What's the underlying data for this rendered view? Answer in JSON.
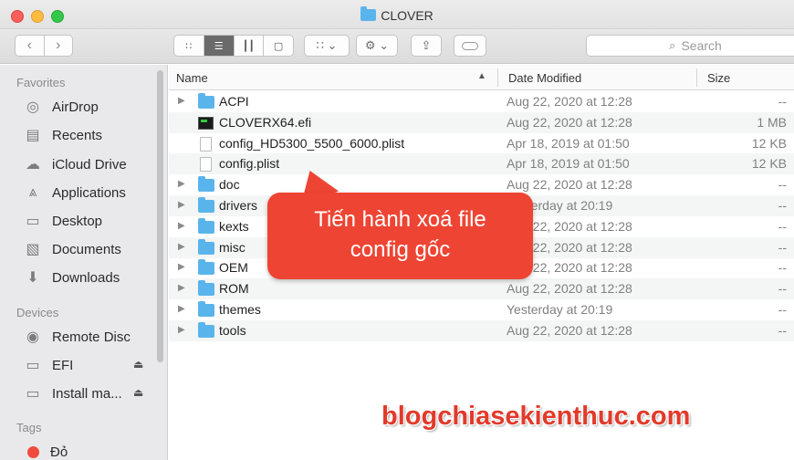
{
  "window": {
    "title": "CLOVER"
  },
  "toolbar": {
    "back": "‹",
    "forward": "›",
    "search_placeholder": "Search"
  },
  "sidebar": {
    "favorites_heading": "Favorites",
    "favorites": [
      {
        "label": "AirDrop",
        "icon": "airdrop-icon"
      },
      {
        "label": "Recents",
        "icon": "recents-icon"
      },
      {
        "label": "iCloud Drive",
        "icon": "cloud-icon"
      },
      {
        "label": "Applications",
        "icon": "applications-icon"
      },
      {
        "label": "Desktop",
        "icon": "desktop-icon"
      },
      {
        "label": "Documents",
        "icon": "documents-icon"
      },
      {
        "label": "Downloads",
        "icon": "downloads-icon"
      }
    ],
    "devices_heading": "Devices",
    "devices": [
      {
        "label": "Remote Disc",
        "icon": "disc-icon"
      },
      {
        "label": "EFI",
        "icon": "drive-icon"
      },
      {
        "label": "Install ma...",
        "icon": "drive-icon"
      }
    ],
    "tags_heading": "Tags",
    "tags": [
      {
        "label": "Đỏ",
        "color": "#f04b3c"
      }
    ]
  },
  "columns": {
    "name": "Name",
    "date": "Date Modified",
    "size": "Size"
  },
  "files": [
    {
      "name": "ACPI",
      "date": "Aug 22, 2020 at 12:28",
      "size": "--",
      "type": "folder"
    },
    {
      "name": "CLOVERX64.efi",
      "date": "Aug 22, 2020 at 12:28",
      "size": "1 MB",
      "type": "efi"
    },
    {
      "name": "config_HD5300_5500_6000.plist",
      "date": "Apr 18, 2019 at 01:50",
      "size": "12 KB",
      "type": "doc"
    },
    {
      "name": "config.plist",
      "date": "Apr 18, 2019 at 01:50",
      "size": "12 KB",
      "type": "doc"
    },
    {
      "name": "doc",
      "date": "Aug 22, 2020 at 12:28",
      "size": "--",
      "type": "folder"
    },
    {
      "name": "drivers",
      "date": "Yesterday at 20:19",
      "size": "--",
      "type": "folder"
    },
    {
      "name": "kexts",
      "date": "Aug 22, 2020 at 12:28",
      "size": "--",
      "type": "folder"
    },
    {
      "name": "misc",
      "date": "Aug 22, 2020 at 12:28",
      "size": "--",
      "type": "folder"
    },
    {
      "name": "OEM",
      "date": "Aug 22, 2020 at 12:28",
      "size": "--",
      "type": "folder"
    },
    {
      "name": "ROM",
      "date": "Aug 22, 2020 at 12:28",
      "size": "--",
      "type": "folder"
    },
    {
      "name": "themes",
      "date": "Yesterday at 20:19",
      "size": "--",
      "type": "folder"
    },
    {
      "name": "tools",
      "date": "Aug 22, 2020 at 12:28",
      "size": "--",
      "type": "folder"
    }
  ],
  "annotation": {
    "line1": "Tiến hành xoá file",
    "line2": "config gốc"
  },
  "watermark": "blogchiasekienthuc.com"
}
